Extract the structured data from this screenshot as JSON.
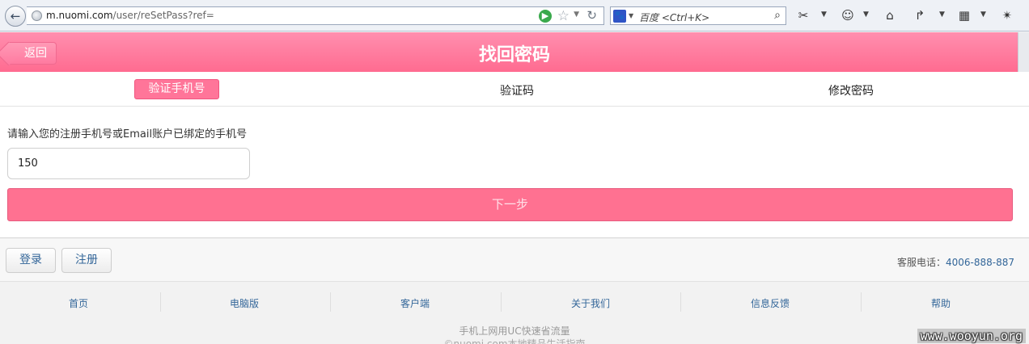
{
  "browser": {
    "url_host": "m.nuomi.com",
    "url_path": "/user/reSetPass?ref=",
    "search_placeholder": "百度 <Ctrl+K>"
  },
  "header": {
    "back_label": "返回",
    "title": "找回密码"
  },
  "steps": [
    {
      "label": "验证手机号",
      "active": true
    },
    {
      "label": "验证码",
      "active": false
    },
    {
      "label": "修改密码",
      "active": false
    }
  ],
  "form": {
    "prompt": "请输入您的注册手机号或Email账户已绑定的手机号",
    "phone_value": "150",
    "next_label": "下一步"
  },
  "account": {
    "login_label": "登录",
    "register_label": "注册",
    "hotline_label": "客服电话：",
    "hotline_number": "4006-888-887"
  },
  "footer_nav": [
    "首页",
    "电脑版",
    "客户端",
    "关于我们",
    "信息反馈",
    "帮助"
  ],
  "footer_note": "手机上网用UC快速省流量",
  "footer_note2": "©nuomi.com本地精品生活指南",
  "watermark": "www.wooyun.org",
  "colors": {
    "brand_pink": "#ff7191",
    "link_blue": "#336699"
  }
}
